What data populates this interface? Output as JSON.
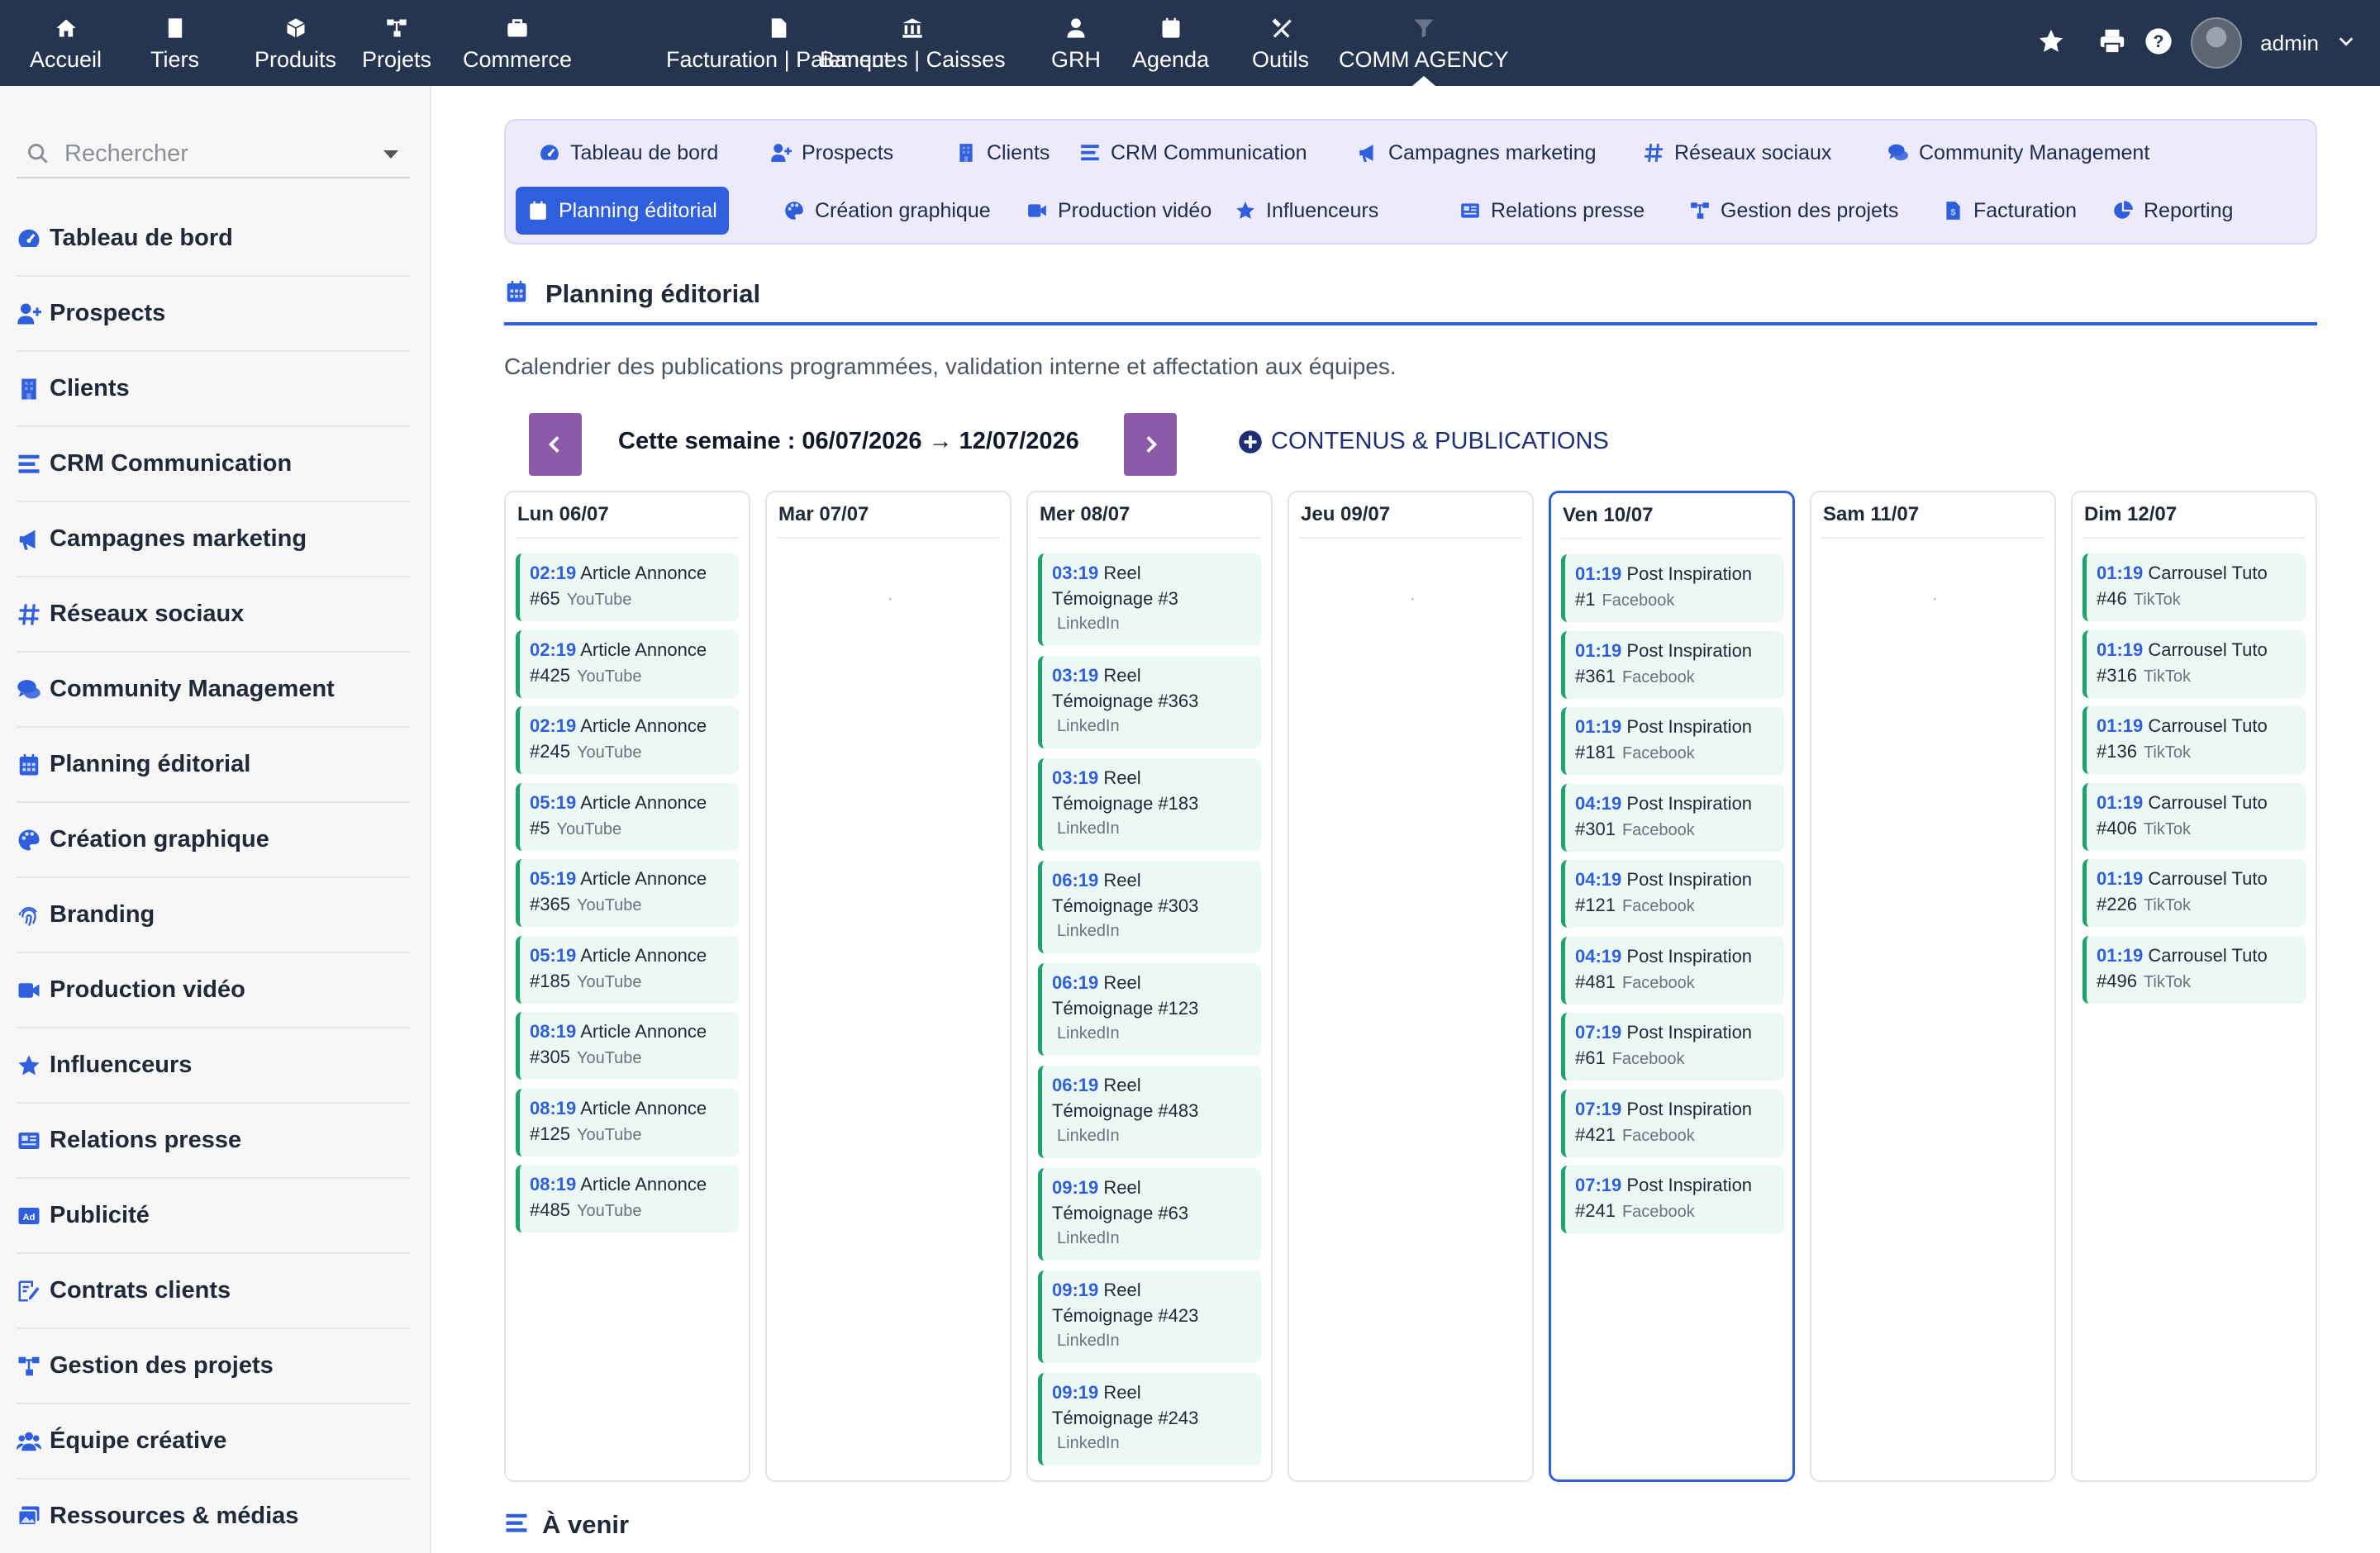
{
  "topnav": {
    "items": [
      {
        "label": "Accueil",
        "icon": "home-icon"
      },
      {
        "label": "Tiers",
        "icon": "building-icon"
      },
      {
        "label": "Produits",
        "icon": "cube-icon"
      },
      {
        "label": "Projets",
        "icon": "sitemap-icon"
      },
      {
        "label": "Commerce",
        "icon": "briefcase-icon"
      },
      {
        "label": "Facturation | Paiement",
        "icon": "invoice-icon"
      },
      {
        "label": "Banques | Caisses",
        "icon": "bank-icon"
      },
      {
        "label": "GRH",
        "icon": "user-tie-icon"
      },
      {
        "label": "Agenda",
        "icon": "calendar-icon"
      },
      {
        "label": "Outils",
        "icon": "tools-icon"
      },
      {
        "label": "COMM AGENCY",
        "icon": "funnel-icon",
        "active": true
      }
    ],
    "user": "admin"
  },
  "sidebar": {
    "search_placeholder": "Rechercher",
    "items": [
      {
        "label": "Tableau de bord",
        "icon": "dashboard-icon"
      },
      {
        "label": "Prospects",
        "icon": "user-plus-icon"
      },
      {
        "label": "Clients",
        "icon": "building-icon"
      },
      {
        "label": "CRM Communication",
        "icon": "list-icon"
      },
      {
        "label": "Campagnes marketing",
        "icon": "megaphone-icon"
      },
      {
        "label": "Réseaux sociaux",
        "icon": "hashtag-icon"
      },
      {
        "label": "Community Management",
        "icon": "comments-icon"
      },
      {
        "label": "Planning éditorial",
        "icon": "calendar-icon"
      },
      {
        "label": "Création graphique",
        "icon": "palette-icon"
      },
      {
        "label": "Branding",
        "icon": "fingerprint-icon"
      },
      {
        "label": "Production vidéo",
        "icon": "video-icon"
      },
      {
        "label": "Influenceurs",
        "icon": "star-icon"
      },
      {
        "label": "Relations presse",
        "icon": "newspaper-icon"
      },
      {
        "label": "Publicité",
        "icon": "ad-icon"
      },
      {
        "label": "Contrats clients",
        "icon": "signature-icon"
      },
      {
        "label": "Gestion des projets",
        "icon": "sitemap-icon"
      },
      {
        "label": "Équipe créative",
        "icon": "users-icon"
      },
      {
        "label": "Ressources & médias",
        "icon": "images-icon"
      }
    ]
  },
  "tabs": {
    "row1": [
      {
        "label": "Tableau de bord",
        "icon": "dashboard-icon"
      },
      {
        "label": "Prospects",
        "icon": "user-plus-icon"
      },
      {
        "label": "Clients",
        "icon": "building-icon"
      },
      {
        "label": "CRM Communication",
        "icon": "list-icon"
      },
      {
        "label": "Campagnes marketing",
        "icon": "megaphone-icon"
      },
      {
        "label": "Réseaux sociaux",
        "icon": "hashtag-icon"
      },
      {
        "label": "Community Management",
        "icon": "comments-icon"
      }
    ],
    "row2": [
      {
        "label": "Planning éditorial",
        "icon": "calendar-icon",
        "active": true
      },
      {
        "label": "Création graphique",
        "icon": "palette-icon"
      },
      {
        "label": "Production vidéo",
        "icon": "video-icon"
      },
      {
        "label": "Influenceurs",
        "icon": "star-icon"
      },
      {
        "label": "Relations presse",
        "icon": "newspaper-icon"
      },
      {
        "label": "Gestion des projets",
        "icon": "sitemap-icon"
      },
      {
        "label": "Facturation",
        "icon": "invoice-icon"
      },
      {
        "label": "Reporting",
        "icon": "pie-chart-icon"
      }
    ]
  },
  "page": {
    "title": "Planning éditorial",
    "description": "Calendrier des publications programmées, validation interne et affectation aux équipes.",
    "week_label": "Cette semaine : 06/07/2026 → 12/07/2026",
    "content_link": "CONTENUS & PUBLICATIONS",
    "upcoming_title": "À venir"
  },
  "colors": {
    "topbar": "#26354f",
    "accent": "#2f5fdc",
    "week_button": "#8c5aa8",
    "card_border": "#1aa56b",
    "card_bg": "#ecf8f3"
  },
  "calendar": {
    "days": [
      {
        "label": "Lun 06/07",
        "empty": "",
        "posts": [
          {
            "time": "02:19",
            "title": "Article Annonce",
            "num": "#65",
            "platform": "YouTube"
          },
          {
            "time": "02:19",
            "title": "Article Annonce",
            "num": "#425",
            "platform": "YouTube"
          },
          {
            "time": "02:19",
            "title": "Article Annonce",
            "num": "#245",
            "platform": "YouTube"
          },
          {
            "time": "05:19",
            "title": "Article Annonce",
            "num": "#5",
            "platform": "YouTube"
          },
          {
            "time": "05:19",
            "title": "Article Annonce",
            "num": "#365",
            "platform": "YouTube"
          },
          {
            "time": "05:19",
            "title": "Article Annonce",
            "num": "#185",
            "platform": "YouTube"
          },
          {
            "time": "08:19",
            "title": "Article Annonce",
            "num": "#305",
            "platform": "YouTube"
          },
          {
            "time": "08:19",
            "title": "Article Annonce",
            "num": "#125",
            "platform": "YouTube"
          },
          {
            "time": "08:19",
            "title": "Article Annonce",
            "num": "#485",
            "platform": "YouTube"
          }
        ]
      },
      {
        "label": "Mar 07/07",
        "empty": "·",
        "posts": []
      },
      {
        "label": "Mer 08/07",
        "empty": "",
        "posts": [
          {
            "time": "03:19",
            "title": "Reel",
            "l2": "Témoignage #3",
            "platform": "LinkedIn"
          },
          {
            "time": "03:19",
            "title": "Reel",
            "l2": "Témoignage #363",
            "platform": "LinkedIn"
          },
          {
            "time": "03:19",
            "title": "Reel",
            "l2": "Témoignage #183",
            "platform": "LinkedIn"
          },
          {
            "time": "06:19",
            "title": "Reel",
            "l2": "Témoignage #303",
            "platform": "LinkedIn"
          },
          {
            "time": "06:19",
            "title": "Reel",
            "l2": "Témoignage #123",
            "platform": "LinkedIn"
          },
          {
            "time": "06:19",
            "title": "Reel",
            "l2": "Témoignage #483",
            "platform": "LinkedIn"
          },
          {
            "time": "09:19",
            "title": "Reel",
            "l2": "Témoignage #63",
            "platform": "LinkedIn"
          },
          {
            "time": "09:19",
            "title": "Reel",
            "l2": "Témoignage #423",
            "platform": "LinkedIn"
          },
          {
            "time": "09:19",
            "title": "Reel",
            "l2": "Témoignage #243",
            "platform": "LinkedIn"
          }
        ]
      },
      {
        "label": "Jeu 09/07",
        "empty": "·",
        "posts": []
      },
      {
        "label": "Ven 10/07",
        "empty": "",
        "today": true,
        "posts": [
          {
            "time": "01:19",
            "title": "Post Inspiration",
            "num": "#1",
            "platform": "Facebook"
          },
          {
            "time": "01:19",
            "title": "Post Inspiration",
            "num": "#361",
            "platform": "Facebook"
          },
          {
            "time": "01:19",
            "title": "Post Inspiration",
            "num": "#181",
            "platform": "Facebook"
          },
          {
            "time": "04:19",
            "title": "Post Inspiration",
            "num": "#301",
            "platform": "Facebook"
          },
          {
            "time": "04:19",
            "title": "Post Inspiration",
            "num": "#121",
            "platform": "Facebook"
          },
          {
            "time": "04:19",
            "title": "Post Inspiration",
            "num": "#481",
            "platform": "Facebook"
          },
          {
            "time": "07:19",
            "title": "Post Inspiration",
            "num": "#61",
            "platform": "Facebook"
          },
          {
            "time": "07:19",
            "title": "Post Inspiration",
            "num": "#421",
            "platform": "Facebook"
          },
          {
            "time": "07:19",
            "title": "Post Inspiration",
            "num": "#241",
            "platform": "Facebook"
          }
        ]
      },
      {
        "label": "Sam 11/07",
        "empty": "·",
        "posts": []
      },
      {
        "label": "Dim 12/07",
        "empty": "",
        "posts": [
          {
            "time": "01:19",
            "title": "Carrousel Tuto",
            "num": "#46",
            "platform": "TikTok"
          },
          {
            "time": "01:19",
            "title": "Carrousel Tuto",
            "num": "#316",
            "platform": "TikTok"
          },
          {
            "time": "01:19",
            "title": "Carrousel Tuto",
            "num": "#136",
            "platform": "TikTok"
          },
          {
            "time": "01:19",
            "title": "Carrousel Tuto",
            "num": "#406",
            "platform": "TikTok"
          },
          {
            "time": "01:19",
            "title": "Carrousel Tuto",
            "num": "#226",
            "platform": "TikTok"
          },
          {
            "time": "01:19",
            "title": "Carrousel Tuto",
            "num": "#496",
            "platform": "TikTok"
          }
        ]
      }
    ]
  }
}
